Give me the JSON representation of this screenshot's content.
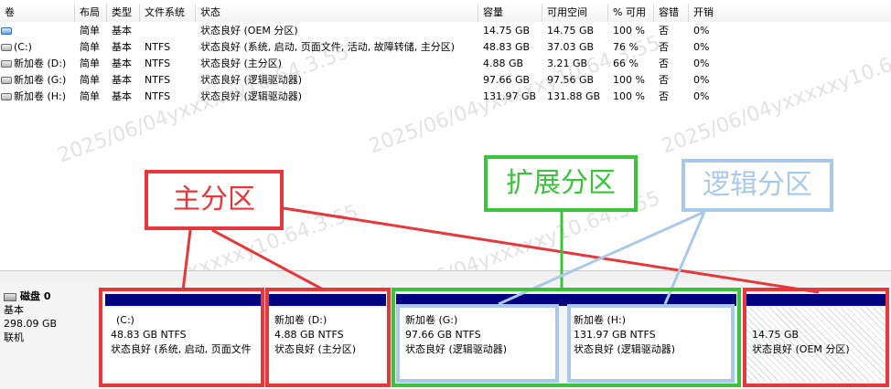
{
  "table": {
    "headers": [
      "卷",
      "布局",
      "类型",
      "文件系统",
      "状态",
      "容量",
      "可用空间",
      "% 可用",
      "容错",
      "开销"
    ],
    "rows": [
      {
        "vol": "",
        "layout": "简单",
        "type": "基本",
        "fs": "",
        "status": "状态良好 (OEM 分区)",
        "capacity": "14.75 GB",
        "free": "14.75 GB",
        "pct": "100 %",
        "fault": "否",
        "overhead": "0%"
      },
      {
        "vol": "(C:)",
        "layout": "简单",
        "type": "基本",
        "fs": "NTFS",
        "status": "状态良好 (系统, 启动, 页面文件, 活动, 故障转储, 主分区)",
        "capacity": "48.83 GB",
        "free": "37.03 GB",
        "pct": "76 %",
        "fault": "否",
        "overhead": "0%"
      },
      {
        "vol": "新加卷 (D:)",
        "layout": "简单",
        "type": "基本",
        "fs": "NTFS",
        "status": "状态良好 (主分区)",
        "capacity": "4.88 GB",
        "free": "3.21 GB",
        "pct": "66 %",
        "fault": "否",
        "overhead": "0%"
      },
      {
        "vol": "新加卷 (G:)",
        "layout": "简单",
        "type": "基本",
        "fs": "NTFS",
        "status": "状态良好 (逻辑驱动器)",
        "capacity": "97.66 GB",
        "free": "97.56 GB",
        "pct": "100 %",
        "fault": "否",
        "overhead": "0%"
      },
      {
        "vol": "新加卷 (H:)",
        "layout": "简单",
        "type": "基本",
        "fs": "NTFS",
        "status": "状态良好 (逻辑驱动器)",
        "capacity": "131.97 GB",
        "free": "131.88 GB",
        "pct": "100 %",
        "fault": "否",
        "overhead": "0%"
      }
    ]
  },
  "disk": {
    "name": "磁盘 0",
    "type": "基本",
    "size": "298.09 GB",
    "state": "联机"
  },
  "partitions": [
    {
      "label": "(C:)",
      "size": "48.83 GB NTFS",
      "status": "状态良好 (系统, 启动, 页面文件"
    },
    {
      "label": "新加卷  (D:)",
      "size": "4.88 GB NTFS",
      "status": "状态良好 (主分区)"
    },
    {
      "label": "新加卷  (G:)",
      "size": "97.66 GB NTFS",
      "status": "状态良好 (逻辑驱动器)"
    },
    {
      "label": "新加卷  (H:)",
      "size": "131.97 GB NTFS",
      "status": "状态良好 (逻辑驱动器)"
    },
    {
      "label": "",
      "size": "14.75 GB",
      "status": "状态良好 (OEM 分区)"
    }
  ],
  "annotations": {
    "primary": "主分区",
    "extended": "扩展分区",
    "logical": "逻辑分区"
  },
  "watermark": "2025/06/04yxxxxxy10.64.3.55",
  "colors": {
    "primary_bar": "#000080",
    "red": "#e8373a",
    "green": "#3cc33c",
    "light_blue": "#a9c9ea"
  }
}
